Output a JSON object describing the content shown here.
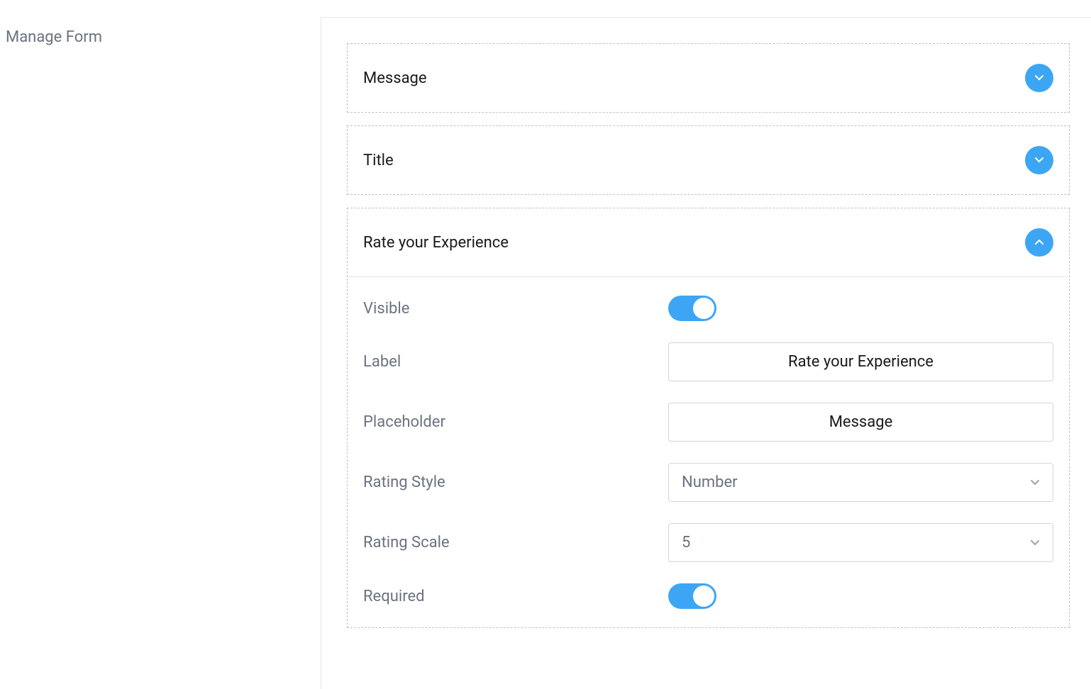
{
  "sidebar": {
    "title": "Manage Form"
  },
  "form": {
    "items": [
      {
        "title": "Message",
        "expanded": false
      },
      {
        "title": "Title",
        "expanded": false
      },
      {
        "title": "Rate your Experience",
        "expanded": true
      }
    ]
  },
  "details": {
    "visible": {
      "label": "Visible",
      "value": true
    },
    "label": {
      "label": "Label",
      "value": "Rate your Experience"
    },
    "placeholder": {
      "label": "Placeholder",
      "value": "Message"
    },
    "ratingStyle": {
      "label": "Rating Style",
      "value": "Number"
    },
    "ratingScale": {
      "label": "Rating Scale",
      "value": "5"
    },
    "required": {
      "label": "Required",
      "value": true
    }
  }
}
